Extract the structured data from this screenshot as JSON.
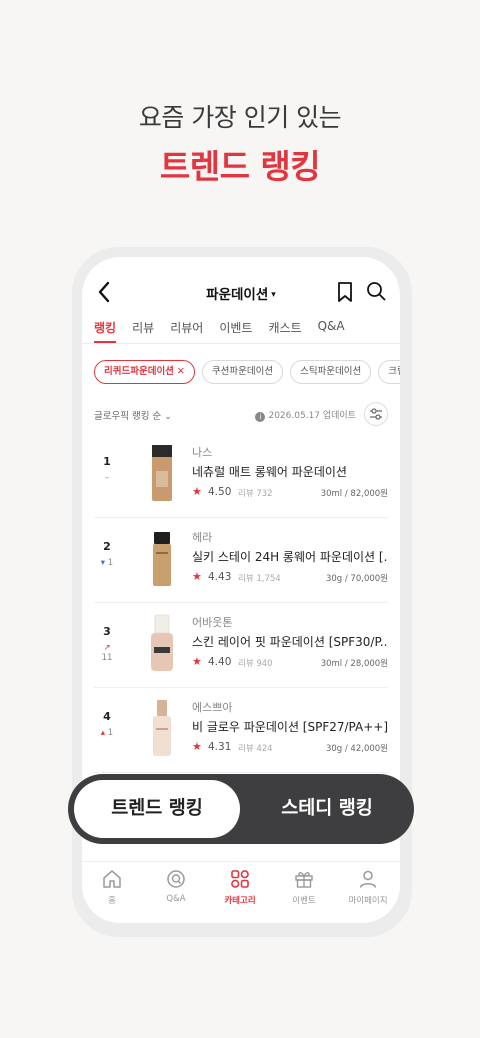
{
  "promo": {
    "subtitle": "요즘 가장 인기 있는",
    "title": "트렌드 랭킹"
  },
  "header": {
    "title": "파운데이션",
    "caret": "▾"
  },
  "tabs": [
    {
      "label": "랭킹",
      "active": true
    },
    {
      "label": "리뷰"
    },
    {
      "label": "리뷰어"
    },
    {
      "label": "이벤트"
    },
    {
      "label": "캐스트"
    },
    {
      "label": "Q&A"
    }
  ],
  "chips": [
    {
      "label": "리퀴드파운데이션",
      "close": "✕",
      "active": true
    },
    {
      "label": "쿠션파운데이션"
    },
    {
      "label": "스틱파운데이션"
    },
    {
      "label": "크림"
    }
  ],
  "sort": {
    "label": "글로우픽 랭킹 순",
    "chevron": "⌄",
    "info_mark": "i",
    "updated": "2026.05.17 업데이트"
  },
  "products": [
    {
      "rank": "1",
      "change": "–",
      "change_dir": "none",
      "brand": "나스",
      "name": "네츄럴 매트 롱웨어 파운데이션",
      "star": "★",
      "rating": "4.50",
      "reviews": "리뷰 732",
      "price": "30ml / 82,000원"
    },
    {
      "rank": "2",
      "change": "1",
      "change_arrow": "▾",
      "change_dir": "down",
      "brand": "헤라",
      "name": "실키 스테이 24H 롱웨어 파운데이션 [...",
      "star": "★",
      "rating": "4.43",
      "reviews": "리뷰 1,754",
      "price": "30g / 70,000원"
    },
    {
      "rank": "3",
      "change": "11",
      "change_arrow": "↗",
      "change_dir": "up",
      "brand": "어바웃톤",
      "name": "스킨 레이어 핏 파운데이션 [SPF30/P...",
      "star": "★",
      "rating": "4.40",
      "reviews": "리뷰 940",
      "price": "30ml / 28,000원"
    },
    {
      "rank": "4",
      "change": "1",
      "change_arrow": "▴",
      "change_dir": "up",
      "brand": "에스쁘아",
      "name": "비 글로우 파운데이션 [SPF27/PA++]",
      "star": "★",
      "rating": "4.31",
      "reviews": "리뷰 424",
      "price": "30g / 42,000원"
    }
  ],
  "toggle": {
    "active": "트렌드 랭킹",
    "inactive": "스테디 랭킹"
  },
  "nav": [
    {
      "label": "홈",
      "icon": "home-icon"
    },
    {
      "label": "Q&A",
      "icon": "qa-icon"
    },
    {
      "label": "카테고리",
      "icon": "category-icon",
      "active": true
    },
    {
      "label": "이벤트",
      "icon": "gift-icon"
    },
    {
      "label": "마이페이지",
      "icon": "person-icon"
    }
  ],
  "colors": {
    "accent": "#e2353f",
    "toggle_bg": "#3e3e40",
    "rank_down": "#3b6fd6"
  }
}
